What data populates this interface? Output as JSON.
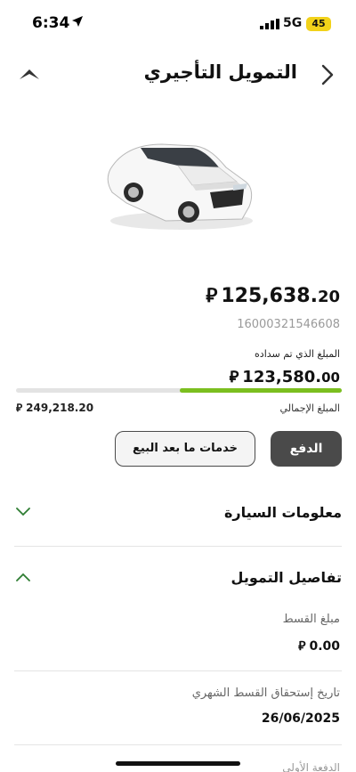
{
  "status": {
    "time": "6:34",
    "network": "5G",
    "battery": "45"
  },
  "header": {
    "title": "التمويل التأجيري"
  },
  "contract": {
    "amount_int": "125,638.",
    "amount_dec": "20",
    "contract_number": "16000321546608",
    "paid_label": "المبلغ الذي تم سداده",
    "paid_int": "123,580.",
    "paid_dec": "00",
    "total_label": "المبلغ الإجمالي",
    "total_amount": "249,218.20",
    "paid_fraction": 0.496,
    "currency_symbol": "⃁"
  },
  "actions": {
    "pay_label": "الدفع",
    "after_sales_label": "خدمات ما بعد البيع"
  },
  "sections": {
    "car_info": "معلومات السيارة",
    "finance_details": "تفاصيل التمويل"
  },
  "finance": {
    "installment_label": "مبلغ القسط",
    "installment_value": "0.00",
    "due_label": "تاريخ إستحقاق القسط الشهري",
    "due_value": "26/06/2025",
    "next_label": "الدفعة الأولى"
  },
  "colors": {
    "accent_green": "#7bbf1f",
    "chevron_green": "#2e7d32",
    "button_dark": "#4a4a4a"
  }
}
